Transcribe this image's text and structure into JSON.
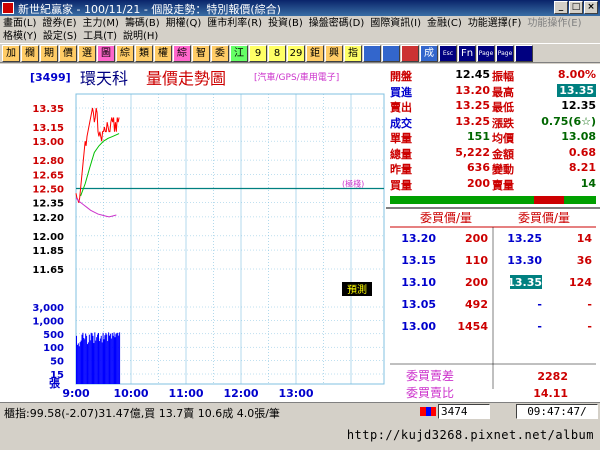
{
  "window": {
    "title": "新世紀贏家 - 100/11/21 - 個股走勢：特別報價(綜合)"
  },
  "menus": {
    "row1": [
      {
        "label": "畫面(L)",
        "enabled": true
      },
      {
        "label": "證券(E)",
        "enabled": true
      },
      {
        "label": "主力(M)",
        "enabled": true
      },
      {
        "label": "籌碼(B)",
        "enabled": true
      },
      {
        "label": "期權(Q)",
        "enabled": true
      },
      {
        "label": "匯市利率(R)",
        "enabled": true
      },
      {
        "label": "投資(B)",
        "enabled": true
      },
      {
        "label": "操盤密碼(D)",
        "enabled": true
      },
      {
        "label": "國際資訊(I)",
        "enabled": true
      },
      {
        "label": "金融(C)",
        "enabled": true
      },
      {
        "label": "功能選擇(F)",
        "enabled": true
      },
      {
        "label": "功能操作(E)",
        "enabled": false
      }
    ],
    "row2": [
      {
        "label": "格模(Y)",
        "enabled": true
      },
      {
        "label": "設定(S)",
        "enabled": true
      },
      {
        "label": "工具(T)",
        "enabled": true
      },
      {
        "label": "說明(H)",
        "enabled": true
      }
    ]
  },
  "toolbar": {
    "buttons": [
      {
        "label": "加",
        "color": "#ffcc66"
      },
      {
        "label": "欄",
        "color": "#ffcc66"
      },
      {
        "label": "期",
        "color": "#ffcc66"
      },
      {
        "label": "價",
        "color": "#ffcc66"
      },
      {
        "label": "選",
        "color": "#ffcc66"
      },
      {
        "label": "圖",
        "color": "#ff66cc"
      },
      {
        "label": "綜",
        "color": "#ffcc66"
      },
      {
        "label": "類",
        "color": "#ffcc66"
      },
      {
        "label": "權",
        "color": "#ffcc66"
      },
      {
        "label": "綜",
        "color": "#ff66cc"
      },
      {
        "label": "智",
        "color": "#ffcc66"
      },
      {
        "label": "委",
        "color": "#ffcc66"
      },
      {
        "label": "江",
        "color": "#66ff66"
      },
      {
        "label": "9",
        "color": "#ffff66"
      },
      {
        "label": "8",
        "color": "#ffff66"
      },
      {
        "label": "29",
        "color": "#ffff66"
      },
      {
        "label": "鉅",
        "color": "#ffcc66"
      },
      {
        "label": "興",
        "color": "#ffcc66"
      },
      {
        "label": "指",
        "color": "#ffff66"
      },
      {
        "label": "",
        "color": "#3366cc"
      },
      {
        "label": "",
        "color": "#3366cc"
      },
      {
        "label": "",
        "color": "#cc3333"
      },
      {
        "label": "成",
        "color": "#3366cc"
      },
      {
        "label": "Esc",
        "color": "#000080"
      },
      {
        "label": "Fn",
        "color": "#000080"
      },
      {
        "label": "Page",
        "color": "#000080"
      },
      {
        "label": "Page",
        "color": "#000080"
      },
      {
        "label": "",
        "color": "#000080"
      }
    ]
  },
  "stock": {
    "code": "[3499]",
    "name": "環天科",
    "chart_title": "量價走勢圖",
    "category": "[汽車/GPS/車用電子]",
    "ref_label": "(極棧)",
    "estimate_tag": "預測"
  },
  "quote": {
    "rows": [
      {
        "l1": "開盤",
        "v1": "12.45",
        "l2": "振幅",
        "v2": "8.00%",
        "v1c": "#000",
        "v2c": "#c00"
      },
      {
        "l1": "買進",
        "v1": "13.20",
        "l2": "最高",
        "v2": "13.35",
        "v1c": "#c00",
        "v2c": "#fff"
      },
      {
        "l1": "賣出",
        "v1": "13.25",
        "l2": "最低",
        "v2": "12.35",
        "v1c": "#c00",
        "v2c": "#000"
      },
      {
        "l1": "成交",
        "v1": "13.25",
        "l2": "漲跌",
        "v2": "0.75(6☆)",
        "v1c": "#c00",
        "v2c": "#006600"
      },
      {
        "l1": "單量",
        "v1": "151",
        "l2": "均價",
        "v2": "13.08",
        "v1c": "#006600",
        "v2c": "#006600"
      },
      {
        "l1": "總量",
        "v1": "5,222",
        "l2": "金額",
        "v2": "0.68",
        "v1c": "#c00",
        "v2c": "#c00"
      },
      {
        "l1": "昨量",
        "v1": "636",
        "l2": "變動",
        "v2": "8.21",
        "v1c": "#c00",
        "v2c": "#c00"
      },
      {
        "l1": "買量",
        "v1": "200",
        "l2": "賣量",
        "v2": "14",
        "v1c": "#c00",
        "v2c": "#006600"
      }
    ]
  },
  "depth": {
    "bid_header": "委買價/量",
    "ask_header": "委買價/量",
    "rows": [
      {
        "bid_price": "13.20",
        "bid_vol": "200",
        "ask_price": "13.25",
        "ask_vol": "14"
      },
      {
        "bid_price": "13.15",
        "bid_vol": "110",
        "ask_price": "13.30",
        "ask_vol": "36"
      },
      {
        "bid_price": "13.10",
        "bid_vol": "200",
        "ask_price": "13.35",
        "ask_vol": "124"
      },
      {
        "bid_price": "13.05",
        "bid_vol": "492",
        "ask_price": "-",
        "ask_vol": "-"
      },
      {
        "bid_price": "13.00",
        "bid_vol": "1454",
        "ask_price": "-",
        "ask_vol": "-"
      }
    ],
    "diff_label": "委買賣差",
    "diff_value": "2282",
    "ratio_label": "委買賣比",
    "ratio_value": "14.11"
  },
  "status": {
    "index_text": "櫃指:99.58(-2.07)31.47億,買 13.7賣 10.6成 4.0張/筆",
    "stock_input": "3474",
    "clock": "09:47:47/"
  },
  "watermark": "http://kujd3268.pixnet.net/album",
  "colors": {
    "grid": "#80c0e0",
    "price_up": "#ff0000",
    "avg_line": "#00c000",
    "ref_line": "#008080",
    "low_line": "#cc33cc",
    "volume": "#0000ff",
    "axis_red": "#cc0000"
  },
  "chart_data": {
    "type": "line",
    "x_ticks": [
      "9:00",
      "10:00",
      "11:00",
      "12:00",
      "13:00"
    ],
    "price_ticks": [
      "13.35",
      "13.15",
      "13.00",
      "12.80",
      "12.65",
      "12.50",
      "12.35",
      "12.20",
      "12.00",
      "11.85",
      "11.65"
    ],
    "price_range": [
      11.65,
      13.35
    ],
    "reference_price": 12.5,
    "volume_ticks": [
      "3,000",
      "1,000",
      "500",
      "100",
      "50",
      "15"
    ],
    "volume_unit": "張",
    "time_range_minutes": [
      0,
      270
    ],
    "series": [
      {
        "type": "price",
        "x": [
          0,
          1,
          2,
          3,
          4,
          5,
          6,
          7,
          8,
          9,
          10,
          11,
          12,
          13,
          14,
          15,
          16,
          17,
          18,
          19,
          20,
          21,
          22,
          23,
          24,
          25,
          26,
          27,
          28,
          29,
          30,
          31,
          32,
          33,
          34,
          35,
          36,
          37,
          38,
          39,
          40,
          41,
          42,
          43,
          44,
          45,
          46,
          47
        ],
        "y": [
          12.45,
          12.4,
          12.38,
          12.35,
          12.4,
          12.5,
          12.6,
          12.7,
          12.8,
          12.9,
          13.0,
          12.95,
          13.05,
          13.1,
          13.15,
          13.2,
          13.25,
          13.3,
          13.35,
          13.3,
          13.2,
          13.25,
          13.35,
          13.3,
          13.1,
          13.05,
          13.1,
          13.05,
          13.0,
          13.1,
          13.1,
          13.15,
          13.1,
          13.1,
          13.2,
          13.15,
          13.1,
          13.1,
          13.2,
          13.25,
          13.2,
          13.25,
          13.1,
          13.2,
          13.1,
          13.25,
          13.2,
          13.25
        ]
      },
      {
        "type": "average",
        "x": [
          5,
          10,
          15,
          20,
          25,
          30,
          35,
          40,
          47
        ],
        "y": [
          12.42,
          12.55,
          12.72,
          12.88,
          12.95,
          13.0,
          13.03,
          13.05,
          13.08
        ]
      },
      {
        "type": "lower_band",
        "x": [
          0,
          4,
          8,
          12,
          16,
          20,
          24,
          28,
          32,
          36,
          40,
          44
        ],
        "y": [
          12.4,
          12.36,
          12.33,
          12.3,
          12.27,
          12.25,
          12.23,
          12.22,
          12.21,
          12.2,
          12.21,
          12.22
        ]
      }
    ],
    "volume": {
      "x": [
        0,
        1,
        2,
        3,
        4,
        5,
        6,
        7,
        8,
        9,
        10,
        11,
        12,
        13,
        14,
        15,
        16,
        17,
        18,
        19,
        20,
        21,
        22,
        23,
        24,
        25,
        26,
        27,
        28,
        29,
        30,
        31,
        32,
        33,
        34,
        35,
        36,
        37,
        38,
        39,
        40,
        41,
        42,
        43,
        44,
        45,
        46,
        47
      ],
      "values": [
        600,
        180,
        220,
        150,
        260,
        320,
        700,
        900,
        450,
        380,
        820,
        600,
        200,
        250,
        700,
        330,
        900,
        850,
        600,
        230,
        950,
        320,
        500,
        720,
        880,
        300,
        420,
        600,
        250,
        900,
        380,
        650,
        880,
        720,
        300,
        950,
        620,
        800,
        420,
        880,
        600,
        950,
        500,
        750,
        880,
        900,
        620,
        950
      ]
    }
  }
}
